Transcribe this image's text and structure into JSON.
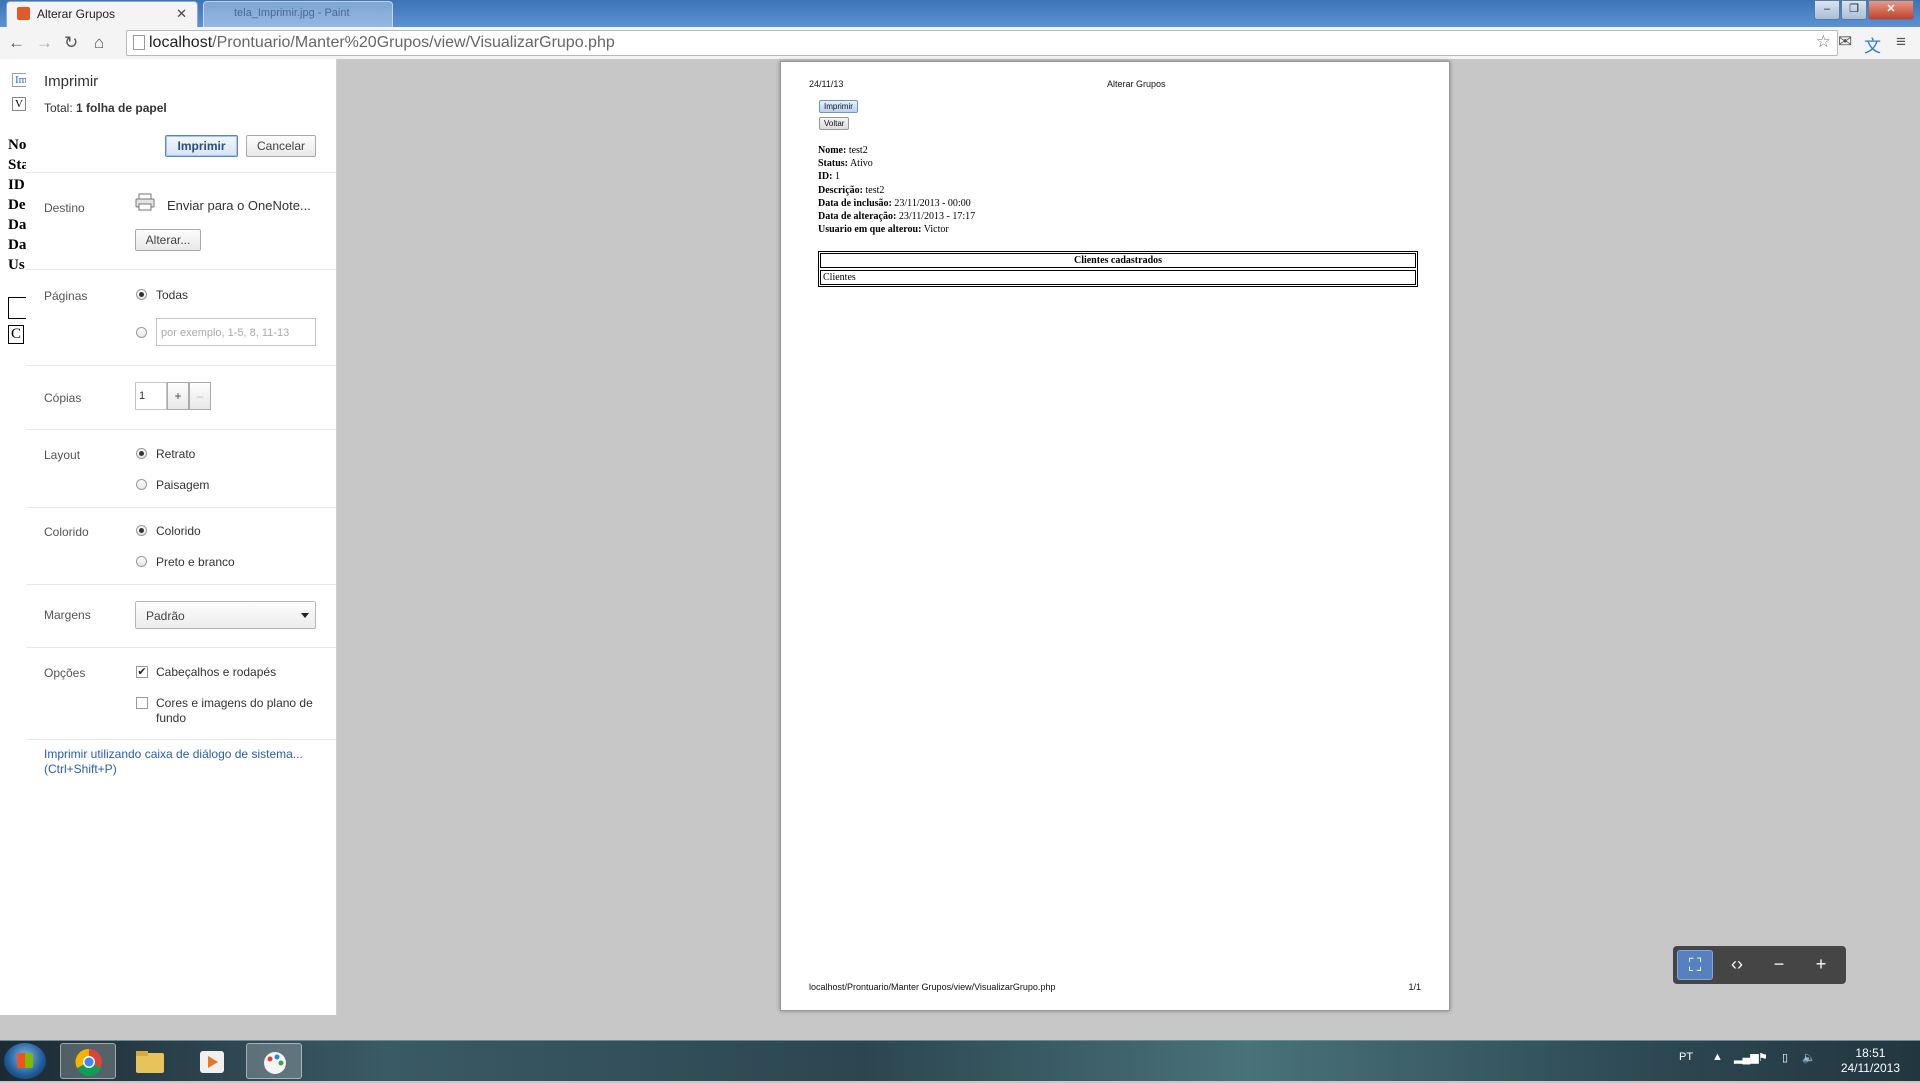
{
  "browser": {
    "active_tab_title": "Alterar Grupos",
    "inactive_tab_title": "tela_Imprimir.jpg - Paint",
    "url_host": "localhost",
    "url_path": "/Prontuario/Manter%20Grupos/view/VisualizarGrupo.php"
  },
  "underlay_letters": [
    "Im",
    "V",
    "No",
    "Sta",
    "ID",
    "De",
    "Da",
    "Da",
    "Us",
    "",
    "C"
  ],
  "print": {
    "heading": "Imprimir",
    "total_label": "Total:",
    "total_value": "1 folha de papel",
    "print_button": "Imprimir",
    "cancel_button": "Cancelar",
    "destination_label": "Destino",
    "destination_value": "Enviar para o OneNote...",
    "change_button": "Alterar...",
    "pages_label": "Páginas",
    "pages_all": "Todas",
    "pages_placeholder": "por exemplo, 1-5, 8, 11-13",
    "copies_label": "Cópias",
    "copies_value": "1",
    "copies_plus": "+",
    "copies_minus": "–",
    "layout_label": "Layout",
    "layout_portrait": "Retrato",
    "layout_landscape": "Paisagem",
    "color_label": "Colorido",
    "color_color": "Colorido",
    "color_bw": "Preto e branco",
    "margins_label": "Margens",
    "margins_value": "Padrão",
    "options_label": "Opções",
    "option_headers": "Cabeçalhos e rodapés",
    "option_backgrounds_line1": "Cores e imagens do plano de",
    "option_backgrounds_line2": "fundo",
    "system_dialog_line1": "Imprimir utilizando caixa de diálogo de sistema...",
    "system_dialog_line2": "(Ctrl+Shift+P)"
  },
  "preview": {
    "header_date": "24/11/13",
    "header_title": "Alterar Grupos",
    "btn_print": "Imprimir",
    "btn_back": "Voltar",
    "fields": [
      {
        "label": "Nome:",
        "value": " test2"
      },
      {
        "label": "Status:",
        "value": " Ativo"
      },
      {
        "label": "ID:",
        "value": " 1"
      },
      {
        "label": "Descrição:",
        "value": " test2"
      },
      {
        "label": "Data de inclusão:",
        "value": " 23/11/2013 - 00:00"
      },
      {
        "label": "Data de alteração:",
        "value": " 23/11/2013 - 17:17"
      },
      {
        "label": "Usuario em que alterou:",
        "value": " Victor"
      }
    ],
    "table_header": "Clientes cadastrados",
    "table_row": "Clientes",
    "footer_url": "localhost/Prontuario/Manter Grupos/view/VisualizarGrupo.php",
    "footer_page": "1/1"
  },
  "taskbar": {
    "language": "PT",
    "time": "18:51",
    "date": "24/11/2013"
  }
}
